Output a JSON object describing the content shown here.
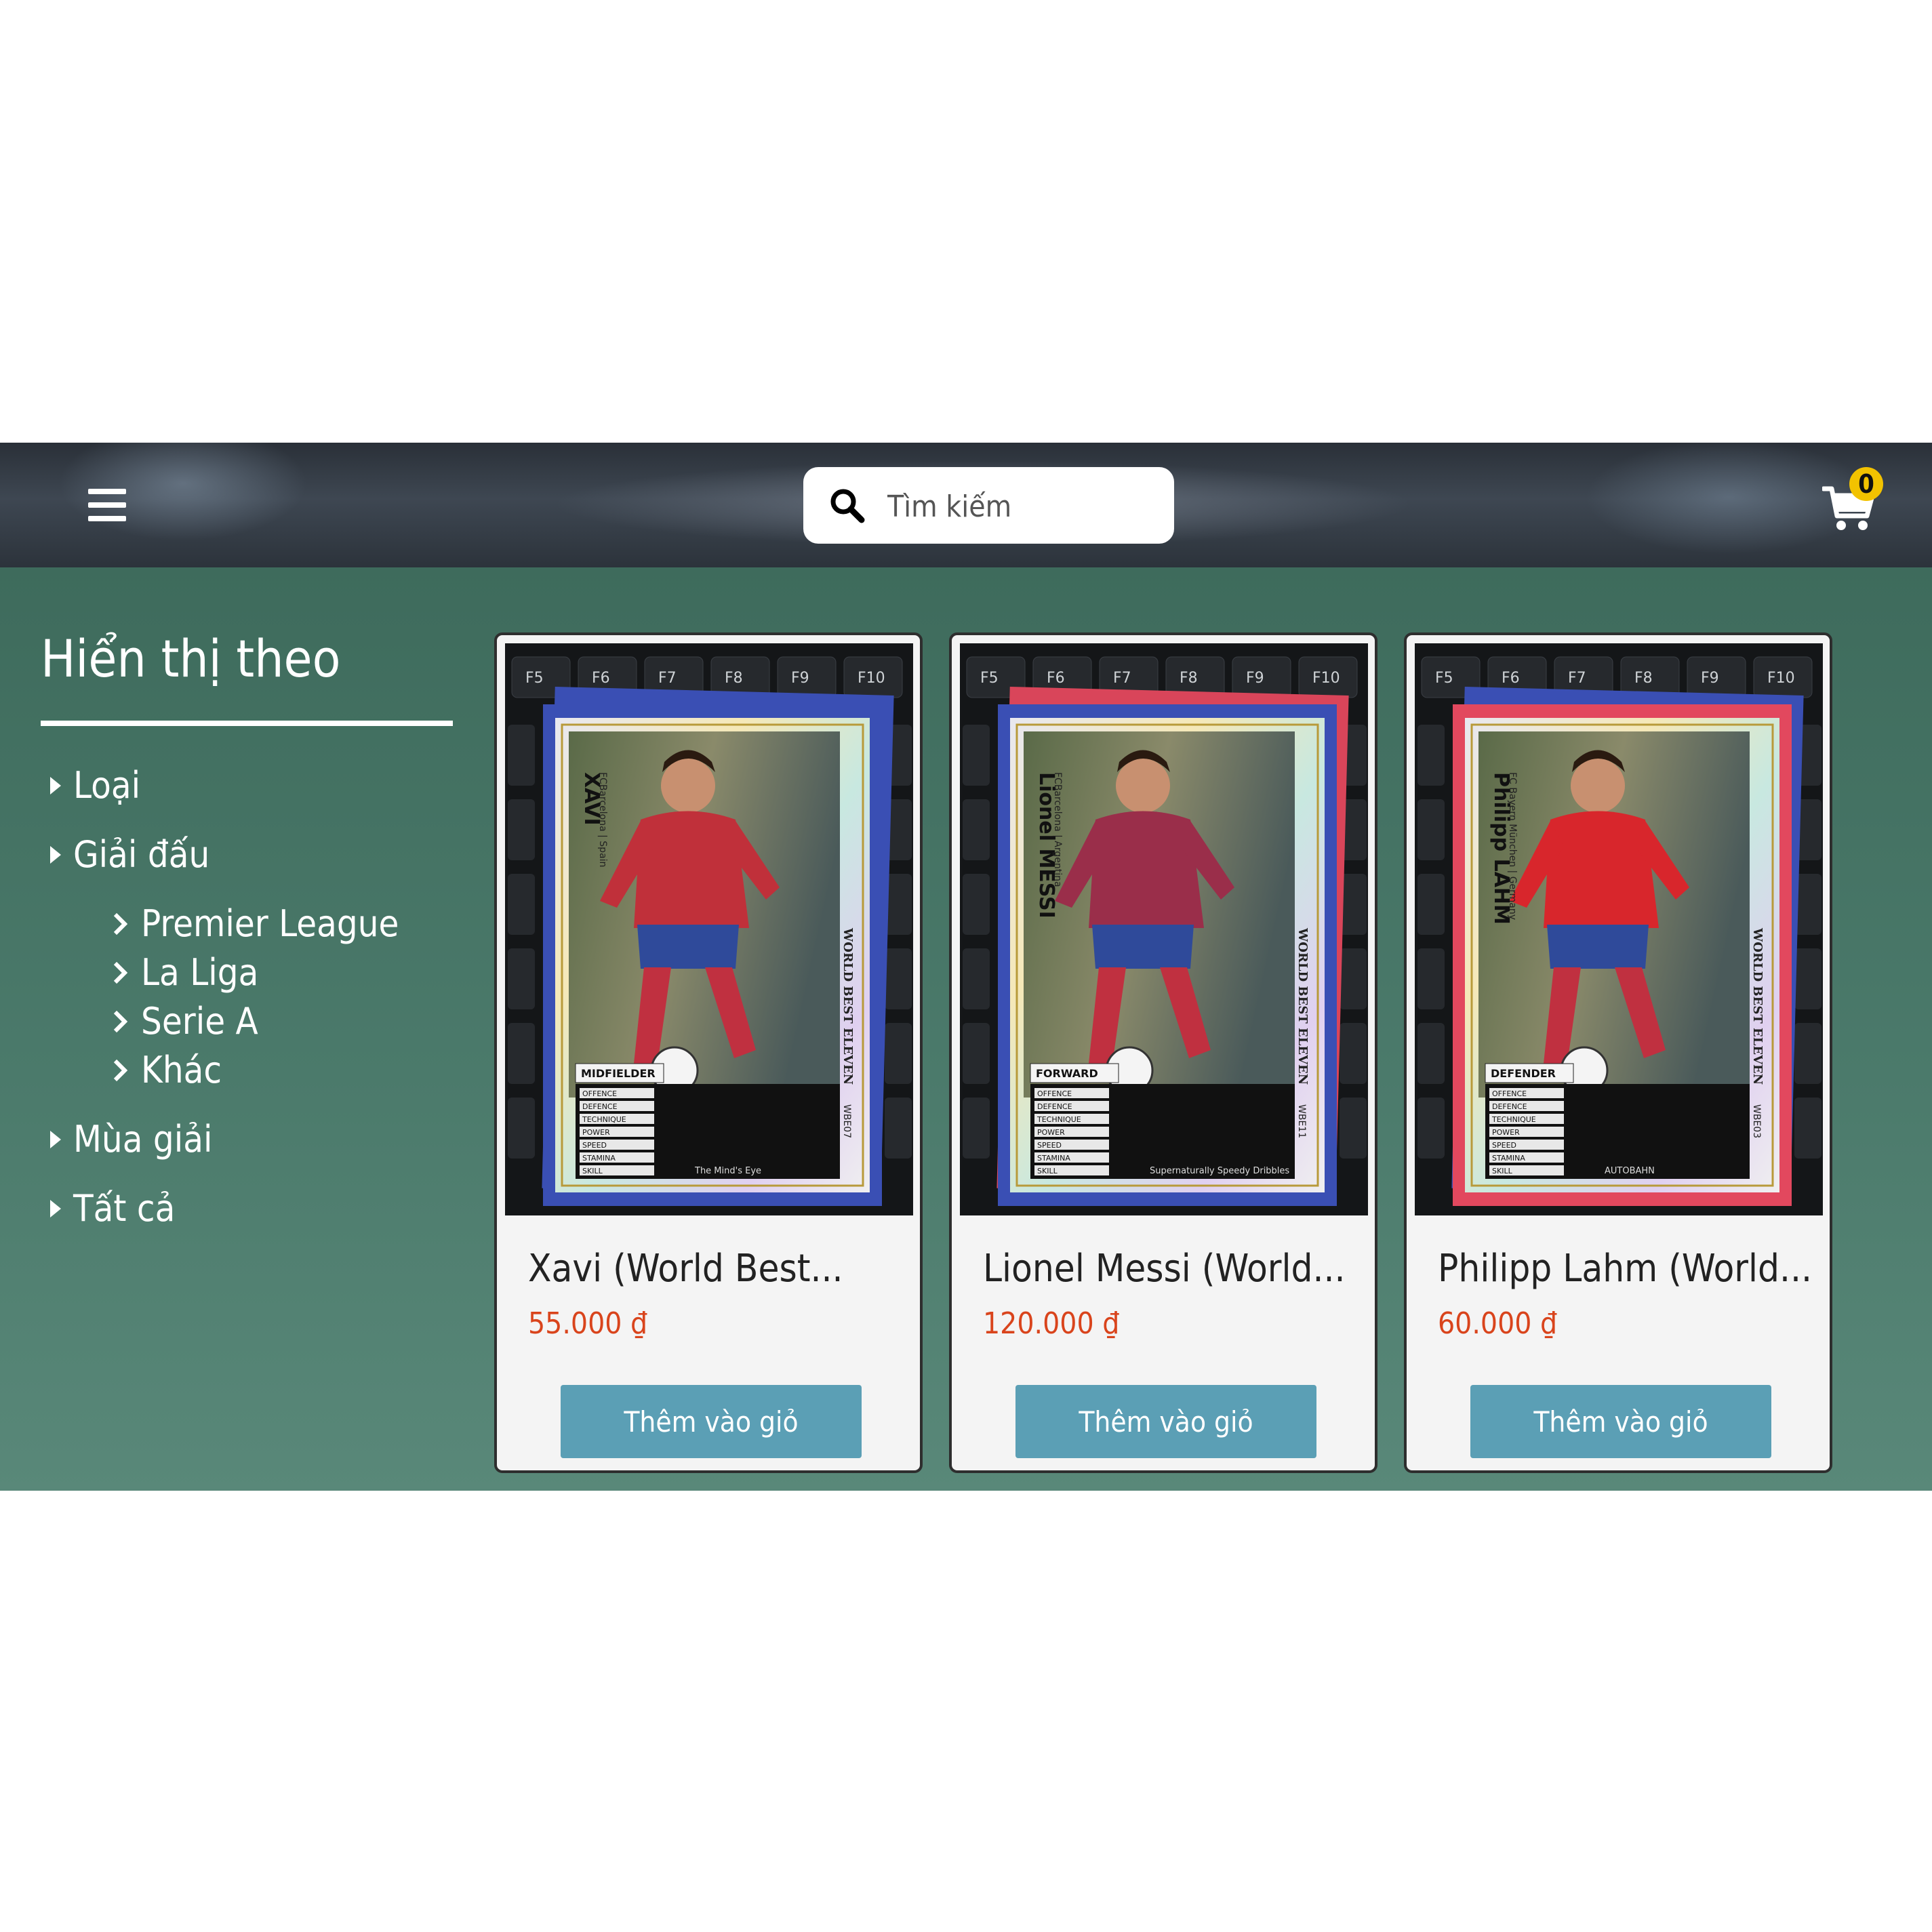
{
  "header": {
    "search_placeholder": "Tìm kiếm",
    "cart_count": "0"
  },
  "sidebar": {
    "title": "Hiển thị theo",
    "categories": [
      {
        "label": "Loại"
      },
      {
        "label": "Giải đấu"
      },
      {
        "label": "Mùa giải"
      },
      {
        "label": "Tất cả"
      }
    ],
    "leagues": [
      {
        "label": "Premier League"
      },
      {
        "label": "La Liga"
      },
      {
        "label": "Serie A"
      },
      {
        "label": "Khác"
      }
    ]
  },
  "products": [
    {
      "title": "Xavi (World Best...",
      "price": "55.000 ₫",
      "button": "Thêm vào giỏ",
      "card": {
        "name": "XAVI",
        "club": "FCBarcelona | Spain",
        "position": "MIDFIELDER",
        "skill": "The Mind's Eye",
        "code": "WBE07",
        "sleeve": "#3a4fb4",
        "sleeve_back": "#3a4fb4",
        "shirt": "#c0303a"
      }
    },
    {
      "title": "Lionel Messi (World...",
      "price": "120.000 ₫",
      "button": "Thêm vào giỏ",
      "card": {
        "name": "Lionel MESSI",
        "club": "FCBarcelona | Argentina",
        "position": "FORWARD",
        "skill": "Supernaturally Speedy Dribbles",
        "code": "WBE11",
        "sleeve": "#3a4fb4",
        "sleeve_back": "#d9455a",
        "shirt": "#9a2e4a"
      }
    },
    {
      "title": "Philipp Lahm (World...",
      "price": "60.000 ₫",
      "button": "Thêm vào giỏ",
      "card": {
        "name": "Philipp LAHM",
        "club": "FC Bayern München | Germany",
        "position": "DEFENDER",
        "skill": "AUTOBAHN",
        "code": "WBE03",
        "sleeve": "#e2485e",
        "sleeve_back": "#3a4fb4",
        "shirt": "#d8262c"
      }
    }
  ],
  "card_series": "WORLD BEST ELEVEN",
  "stat_labels": [
    "OFFENCE",
    "DEFENCE",
    "TECHNIQUE",
    "POWER",
    "SPEED",
    "STAMINA",
    "SKILL"
  ]
}
